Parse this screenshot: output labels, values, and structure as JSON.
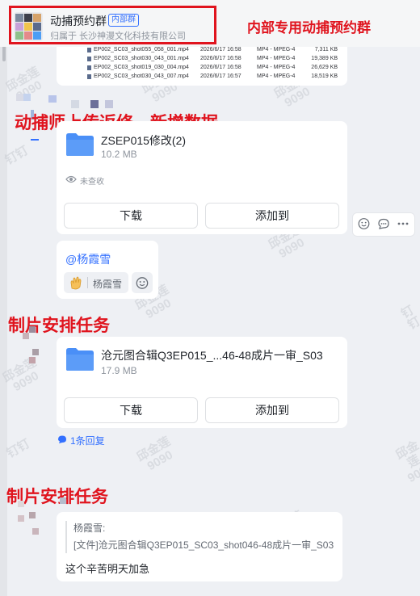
{
  "header": {
    "group_name": "动捕预约群",
    "badge": "内部群",
    "org_line": "归属于 长沙神漫文化科技有限公司",
    "annotation": "内部专用动捕预约群"
  },
  "file_list": {
    "rows": [
      {
        "name": "EP002_SC03_shot055_058_001.mp4",
        "date": "2026/6/17 16:58",
        "type": "MP4 - MPEG-4",
        "size": "7,311 KB"
      },
      {
        "name": "EP002_SC03_shot030_043_001.mp4",
        "date": "2026/6/17 16:58",
        "type": "MP4 - MPEG-4",
        "size": "19,389 KB"
      },
      {
        "name": "EP002_SC03_shot019_030_004.mp4",
        "date": "2026/6/17 16:58",
        "type": "MP4 - MPEG-4",
        "size": "26,629 KB"
      },
      {
        "name": "EP002_SC03_shot030_043_007.mp4",
        "date": "2026/6/17 16:57",
        "type": "MP4 - MPEG-4",
        "size": "18,519 KB"
      }
    ]
  },
  "annotations": {
    "mocap": "动捕师上传返修、新增数据",
    "task1": "制片安排任务",
    "task2": "制片安排任务"
  },
  "msg1": {
    "file_name": "ZSEP015修改(2)",
    "file_size": "10.2 MB",
    "read_status": "未查收",
    "download": "下载",
    "add_to": "添加到"
  },
  "mention": {
    "text": "@杨霞雪",
    "reaction_name": "杨霞雪"
  },
  "msg2": {
    "file_name": "沧元图合辑Q3EP015_...46-48成片一审_S03",
    "file_size": "17.9 MB",
    "download": "下载",
    "add_to": "添加到",
    "reply_count": "1条回复"
  },
  "msg3": {
    "quote_author": "杨霞雪:",
    "quote_text": "[文件]沧元图合辑Q3EP015_SC03_shot046-48成片一审_S03",
    "body": "这个辛苦明天加急"
  },
  "watermark": {
    "name": "邱金莲",
    "id": "9090",
    "brand": "钉钉"
  },
  "colors": {
    "accent": "#3370ff",
    "annotation": "#e0141e",
    "folder": "#4a8ff7"
  }
}
